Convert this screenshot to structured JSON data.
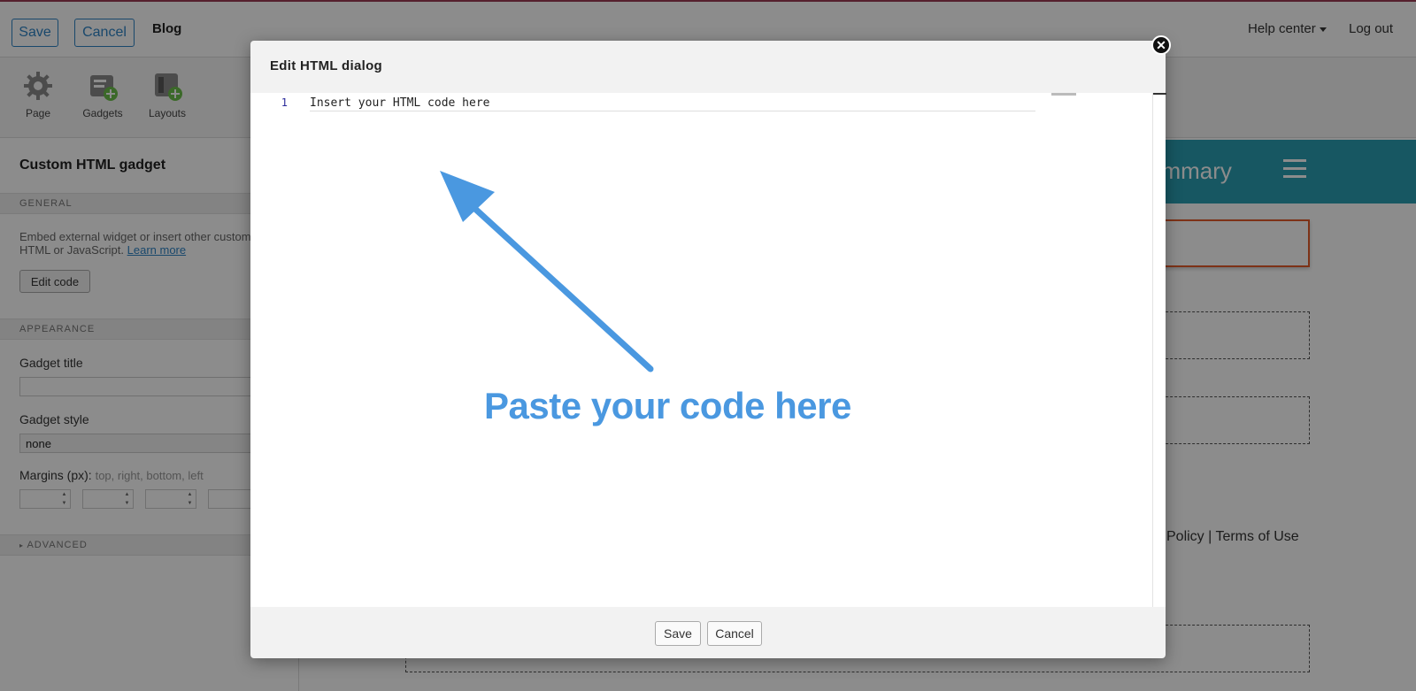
{
  "topbar": {
    "save_label": "Save",
    "cancel_label": "Cancel",
    "title": "Blog",
    "help_label": "Help center",
    "logout_label": "Log out"
  },
  "toolbar": {
    "items": [
      {
        "label": "Page",
        "icon": "gear-icon"
      },
      {
        "label": "Gadgets",
        "icon": "add-gadget-icon"
      },
      {
        "label": "Layouts",
        "icon": "add-layout-icon"
      }
    ]
  },
  "sidebar": {
    "title": "Custom HTML gadget",
    "general_label": "GENERAL",
    "description": "Embed external widget or insert other custom HTML or JavaScript.",
    "learn_more": "Learn more",
    "edit_code_label": "Edit code",
    "appearance_label": "APPEARANCE",
    "gadget_title_label": "Gadget title",
    "gadget_title_value": "",
    "gadget_style_label": "Gadget style",
    "gadget_style_value": "none",
    "margins_label": "Margins (px):",
    "margins_hint": "top, right, bottom, left",
    "advanced_label": "ADVANCED"
  },
  "preview": {
    "header_text": "ummary",
    "footer_text": "Policy | Terms of Use",
    "accent_color": "#2a9fb3"
  },
  "dialog": {
    "title": "Edit HTML dialog",
    "line_number": "1",
    "code_placeholder": "Insert your HTML code here",
    "annotation": "Paste your code here",
    "save_label": "Save",
    "cancel_label": "Cancel",
    "annotation_color": "#4a98e0"
  }
}
